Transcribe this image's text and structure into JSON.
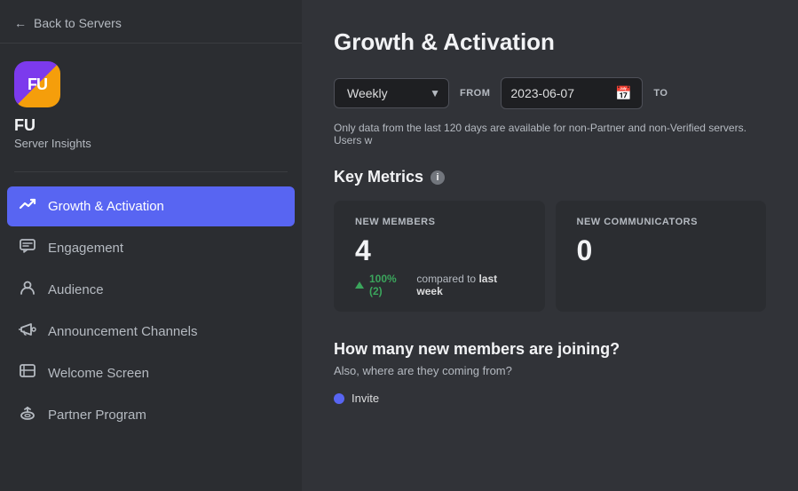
{
  "sidebar": {
    "back_label": "Back to Servers",
    "server_icon_text": "FU",
    "server_name": "FU",
    "server_subtitle": "Server Insights",
    "nav_items": [
      {
        "id": "growth",
        "label": "Growth & Activation",
        "icon": "📈",
        "active": true
      },
      {
        "id": "engagement",
        "label": "Engagement",
        "icon": "💬",
        "active": false
      },
      {
        "id": "audience",
        "label": "Audience",
        "icon": "👤",
        "active": false
      },
      {
        "id": "announcement",
        "label": "Announcement Channels",
        "icon": "📣",
        "active": false
      },
      {
        "id": "welcome",
        "label": "Welcome Screen",
        "icon": "🖥",
        "active": false
      },
      {
        "id": "partner",
        "label": "Partner Program",
        "icon": "🛸",
        "active": false
      }
    ]
  },
  "main": {
    "page_title": "Growth & Activation",
    "filter": {
      "period_label": "Weekly",
      "from_label": "FROM",
      "from_date": "2023-06-07",
      "to_label": "TO"
    },
    "info_text": "Only data from the last 120 days are available for non-Partner and non-Verified servers. Users w",
    "key_metrics": {
      "title": "Key Metrics",
      "cards": [
        {
          "label": "NEW MEMBERS",
          "value": "4",
          "trend_direction": "up",
          "trend_value": "100%",
          "trend_count": "2",
          "trend_period": "last week"
        },
        {
          "label": "NEW COMMUNICATORS",
          "value": "0",
          "trend_direction": null,
          "trend_value": null,
          "trend_period": null
        }
      ]
    },
    "join_section": {
      "title": "How many new members are joining?",
      "subtitle": "Also, where are they coming from?",
      "legend": [
        {
          "color": "#5865f2",
          "label": "Invite"
        }
      ]
    }
  }
}
